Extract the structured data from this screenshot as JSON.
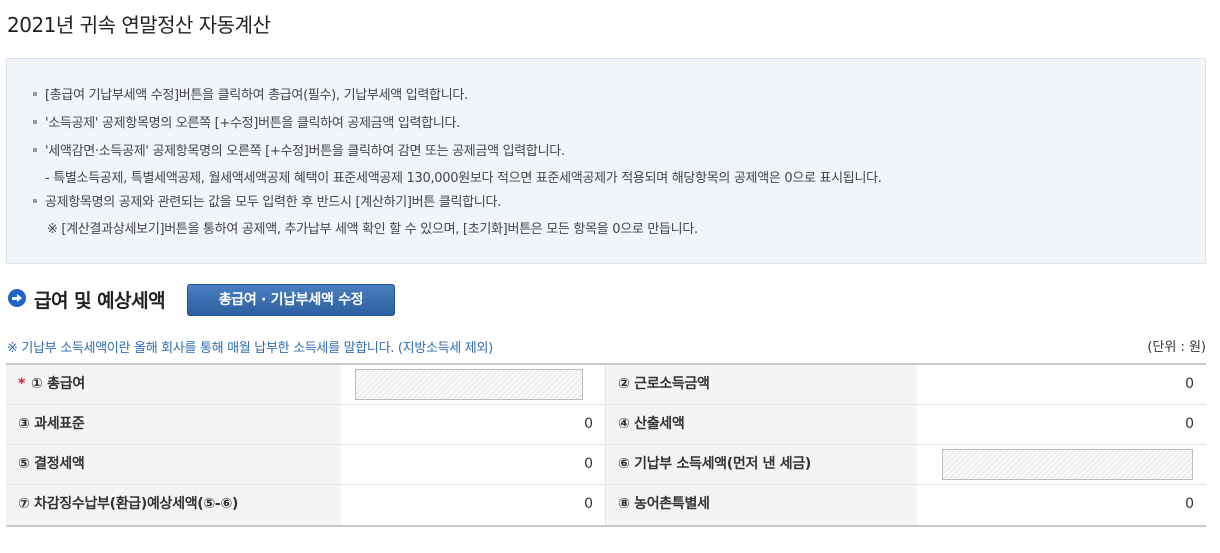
{
  "page": {
    "title": "2021년 귀속 연말정산 자동계산"
  },
  "info": {
    "lines": [
      "[총급여 기납부세액 수정]버튼을 클릭하여 총급여(필수), 기납부세액 입력합니다.",
      "'소득공제' 공제항목명의 오른쪽 [+수정]버튼을 클릭하여 공제금액 입력합니다.",
      "'세액감면·소득공제' 공제항목명의 오른쪽 [+수정]버튼을 클릭하여 감면 또는 공제금액 입력합니다.",
      "- 특별소득공제, 특별세액공제, 월세액세액공제 혜택이 표준세액공제 130,000원보다 적으면 표준세액공제가 적용되며 해당항목의 공제액은 0으로 표시됩니다.",
      "공제항목명의 공제와 관련되는 값을 모두 입력한 후 반드시 [계산하기]버튼 클릭합니다.",
      "※ [계산결과상세보기]버튼을 통하여 공제액, 추가납부 세액 확인 할 수 있으며, [초기화]버튼은 모든 항목을 0으로 만듭니다."
    ]
  },
  "section": {
    "title": "급여 및 예상세액",
    "edit_button": "총급여 · 기납부세액 수정",
    "note": "※ 기납부 소득세액이란 올해 회사를 통해 매월 납부한 소득세를 말합니다. (지방소득세 제외)",
    "unit": "(단위 : 원)"
  },
  "table": {
    "required_mark": "*",
    "rows": [
      {
        "left_label": "① 총급여",
        "left_value": "",
        "right_label": "② 근로소득금액",
        "right_value": "0"
      },
      {
        "left_label": "③ 과세표준",
        "left_value": "0",
        "right_label": "④ 산출세액",
        "right_value": "0"
      },
      {
        "left_label": "⑤ 결정세액",
        "left_value": "0",
        "right_label": "⑥ 기납부 소득세액(먼저 낸 세금)",
        "right_value": ""
      },
      {
        "left_label": "⑦ 차감징수납부(환급)예상세액(⑤-⑥)",
        "left_value": "0",
        "right_label": "⑧ 농어촌특별세",
        "right_value": "0"
      }
    ]
  },
  "colors": {
    "accent": "#2d5f9f",
    "note_text": "#2f6db0",
    "required": "#d0202b",
    "info_bg": "#f1f5f9"
  }
}
